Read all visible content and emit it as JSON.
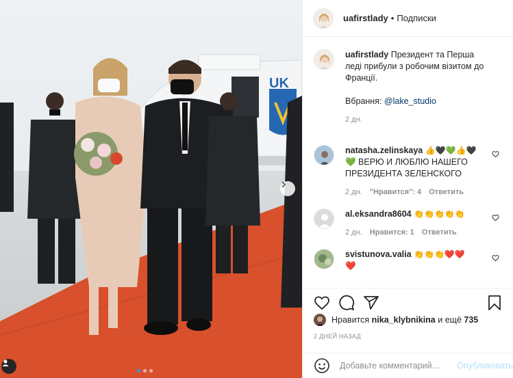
{
  "post": {
    "author": "uafirstlady",
    "follow_label": "Подписки",
    "carousel_dots": 3,
    "active_dot": 0
  },
  "caption": {
    "username": "uafirstlady",
    "text": "Президент та Перша леді прибули з робочим візитом до Франції.",
    "credit_prefix": "Вбрання: ",
    "credit_link": "@lake_studio",
    "time": "2 дн."
  },
  "comments": [
    {
      "username": "natasha.zelinskaya",
      "emoji_line": "👍🖤💚👍🖤",
      "text": "💚 ВЕРЮ И ЛЮБЛЮ НАШЕГО ПРЕЗИДЕНТА ЗЕЛЕНСКОГО",
      "time": "2 дн.",
      "likes": "\"Нравится\": 4",
      "reply": "Ответить"
    },
    {
      "username": "al.eksandra8604",
      "emoji_line": "👏👏👏👏👏",
      "text": "",
      "time": "2 дн.",
      "likes": "Нравится: 1",
      "reply": "Ответить"
    },
    {
      "username": "svistunova.valia",
      "emoji_line": "👏👏👏❤️❤️",
      "text": "❤️",
      "time": "",
      "likes": "",
      "reply": ""
    }
  ],
  "likes_line": {
    "prefix": "Нравится ",
    "user": "nika_klybnikina",
    "middle": " и ещё ",
    "count": "735"
  },
  "time_ago": "2 ДНЕЙ НАЗАД",
  "add_comment": {
    "placeholder": "Добавьте комментарий...",
    "publish_label": "Опубликовать"
  },
  "icons": [
    "heart-icon",
    "comment-icon",
    "share-icon",
    "bookmark-icon",
    "emoji-icon",
    "next-arrow-icon",
    "tagged-user-icon",
    "like-comment-icon"
  ],
  "colors": {
    "link": "#00376b",
    "publish_disabled": "#b2dffc",
    "carousel_active": "#3897f0",
    "muted": "#8e8e8e"
  }
}
